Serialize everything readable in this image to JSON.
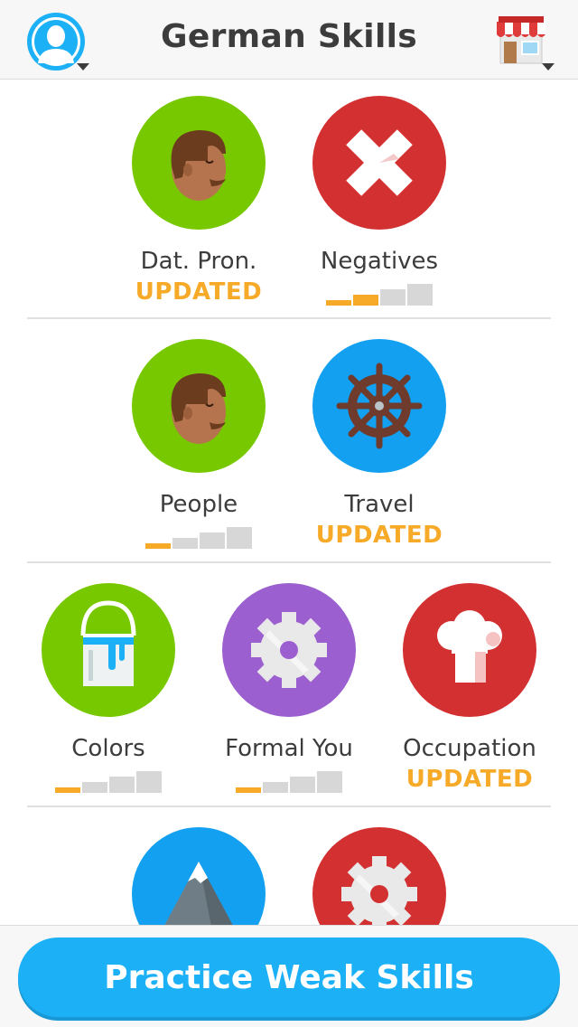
{
  "header": {
    "title": "German Skills",
    "avatar_icon": "user-avatar-icon",
    "shop_icon": "shop-icon"
  },
  "skills": [
    {
      "name": "Dat. Pron.",
      "color": "#78c800",
      "icon": "face-icon",
      "status": "UPDATED",
      "strength": null
    },
    {
      "name": "Negatives",
      "color": "#d33131",
      "icon": "cross-icon",
      "status": null,
      "strength": 2
    },
    {
      "name": "People",
      "color": "#78c800",
      "icon": "face-icon",
      "status": null,
      "strength": 1
    },
    {
      "name": "Travel",
      "color": "#14a0f0",
      "icon": "ship-wheel-icon",
      "status": "UPDATED",
      "strength": null
    },
    {
      "name": "Colors",
      "color": "#78c800",
      "icon": "paint-bucket-icon",
      "status": null,
      "strength": 1
    },
    {
      "name": "Formal You",
      "color": "#9b5fcf",
      "icon": "gear-icon",
      "status": null,
      "strength": 1
    },
    {
      "name": "Occupation",
      "color": "#d33131",
      "icon": "chef-hat-icon",
      "status": "UPDATED",
      "strength": null
    },
    {
      "name": "",
      "color": "#14a0f0",
      "icon": "mountain-icon",
      "status": null,
      "strength": null
    },
    {
      "name": "",
      "color": "#d33131",
      "icon": "gear-icon",
      "status": null,
      "strength": null
    }
  ],
  "footer": {
    "practice_label": "Practice Weak Skills"
  }
}
